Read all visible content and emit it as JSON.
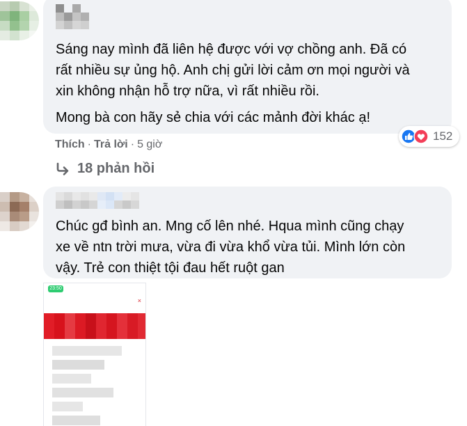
{
  "comment1": {
    "text": "Sáng nay mình đã liên hệ được với vợ chồng anh. Đã có\nrất nhiều sự ủng hộ. Anh chị gửi lời cảm ơn mọi người và\nxin không nhận hỗ trợ nữa, vì rất nhiều rồi.",
    "text2": "Mong bà con hãy sẻ chia với các mảnh đời khác ạ!",
    "actions": {
      "like": "Thích",
      "sep": "·",
      "reply": "Trả lời",
      "time": "5 giờ"
    },
    "reactions": {
      "icons": [
        "like-icon",
        "love-icon"
      ],
      "count": "152"
    },
    "replies": {
      "icon": "reply-arrow-icon",
      "label": "18 phản hồi"
    }
  },
  "comment2": {
    "text": "Chúc gđ bình an. Mng cố lên nhé. Hqua mình cũng chạy\nxe về ntn trời mưa, vừa đi vừa khổ vừa tủi. Mình lớn còn\nvậy. Trẻ con thiệt tội đau hết ruột gan",
    "attachment": {
      "status_time": "23:50",
      "close": "×"
    }
  },
  "colors": {
    "bubble": "#f0f2f5",
    "secondary_text": "#65676b",
    "like_blue": "#1877f2",
    "love_red": "#f33e58"
  }
}
